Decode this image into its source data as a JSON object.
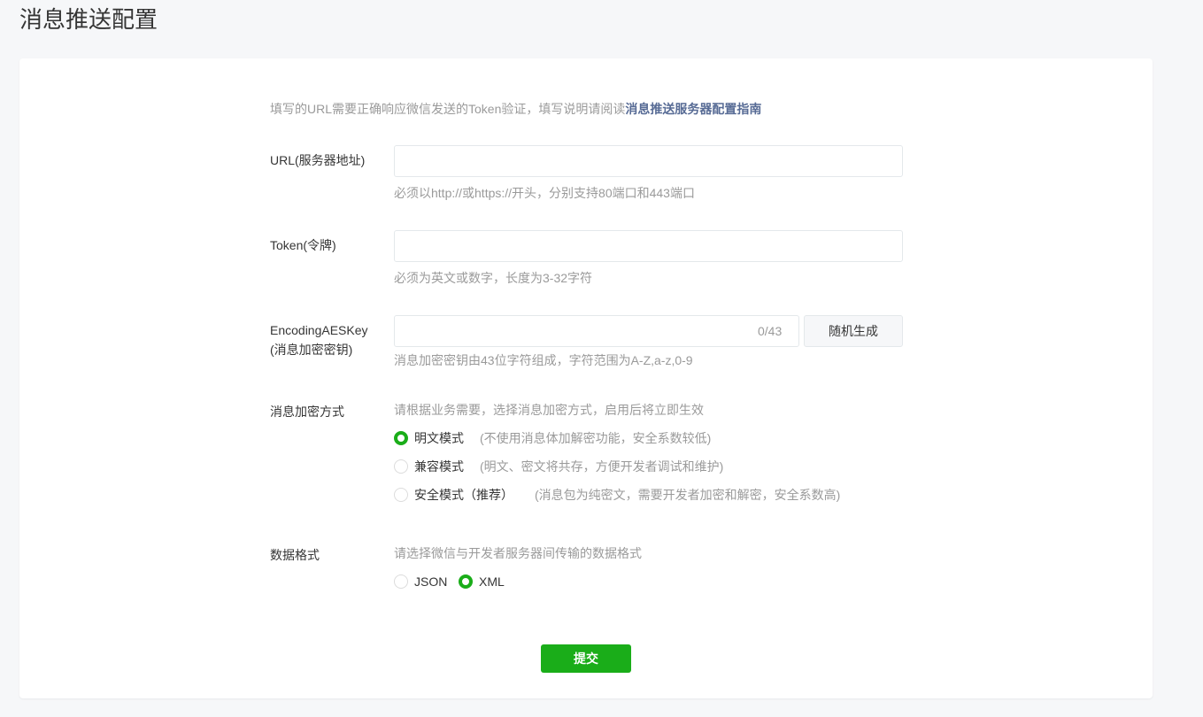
{
  "page": {
    "title": "消息推送配置"
  },
  "form": {
    "tip": {
      "text": "填写的URL需要正确响应微信发送的Token验证，填写说明请阅读",
      "link": "消息推送服务器配置指南"
    },
    "url": {
      "label": "URL(服务器地址)",
      "value": "",
      "placeholder": "",
      "hint": "必须以http://或https://开头，分别支持80端口和443端口"
    },
    "token": {
      "label": "Token(令牌)",
      "value": "",
      "placeholder": "",
      "hint": "必须为英文或数字，长度为3-32字符"
    },
    "aes_key": {
      "label_line1": "EncodingAESKey",
      "label_line2": "(消息加密密钥)",
      "value": "",
      "counter": "0/43",
      "generate_button": "随机生成",
      "hint": "消息加密密钥由43位字符组成，字符范围为A-Z,a-z,0-9"
    },
    "encryption": {
      "label": "消息加密方式",
      "hint": "请根据业务需要，选择消息加密方式，启用后将立即生效",
      "options": [
        {
          "label": "明文模式",
          "desc": "(不使用消息体加解密功能，安全系数较低)",
          "checked": true
        },
        {
          "label": "兼容模式",
          "desc": "(明文、密文将共存，方便开发者调试和维护)",
          "checked": false
        },
        {
          "label": "安全模式（推荐）",
          "desc": "(消息包为纯密文，需要开发者加密和解密，安全系数高)",
          "checked": false
        }
      ]
    },
    "data_format": {
      "label": "数据格式",
      "hint": "请选择微信与开发者服务器间传输的数据格式",
      "options": [
        {
          "label": "JSON",
          "checked": false
        },
        {
          "label": "XML",
          "checked": true
        }
      ]
    },
    "submit_label": "提交"
  },
  "colors": {
    "accent": "#1aad19",
    "link": "#576b95",
    "muted": "#9a9a9a",
    "background": "#f6f7f9"
  }
}
